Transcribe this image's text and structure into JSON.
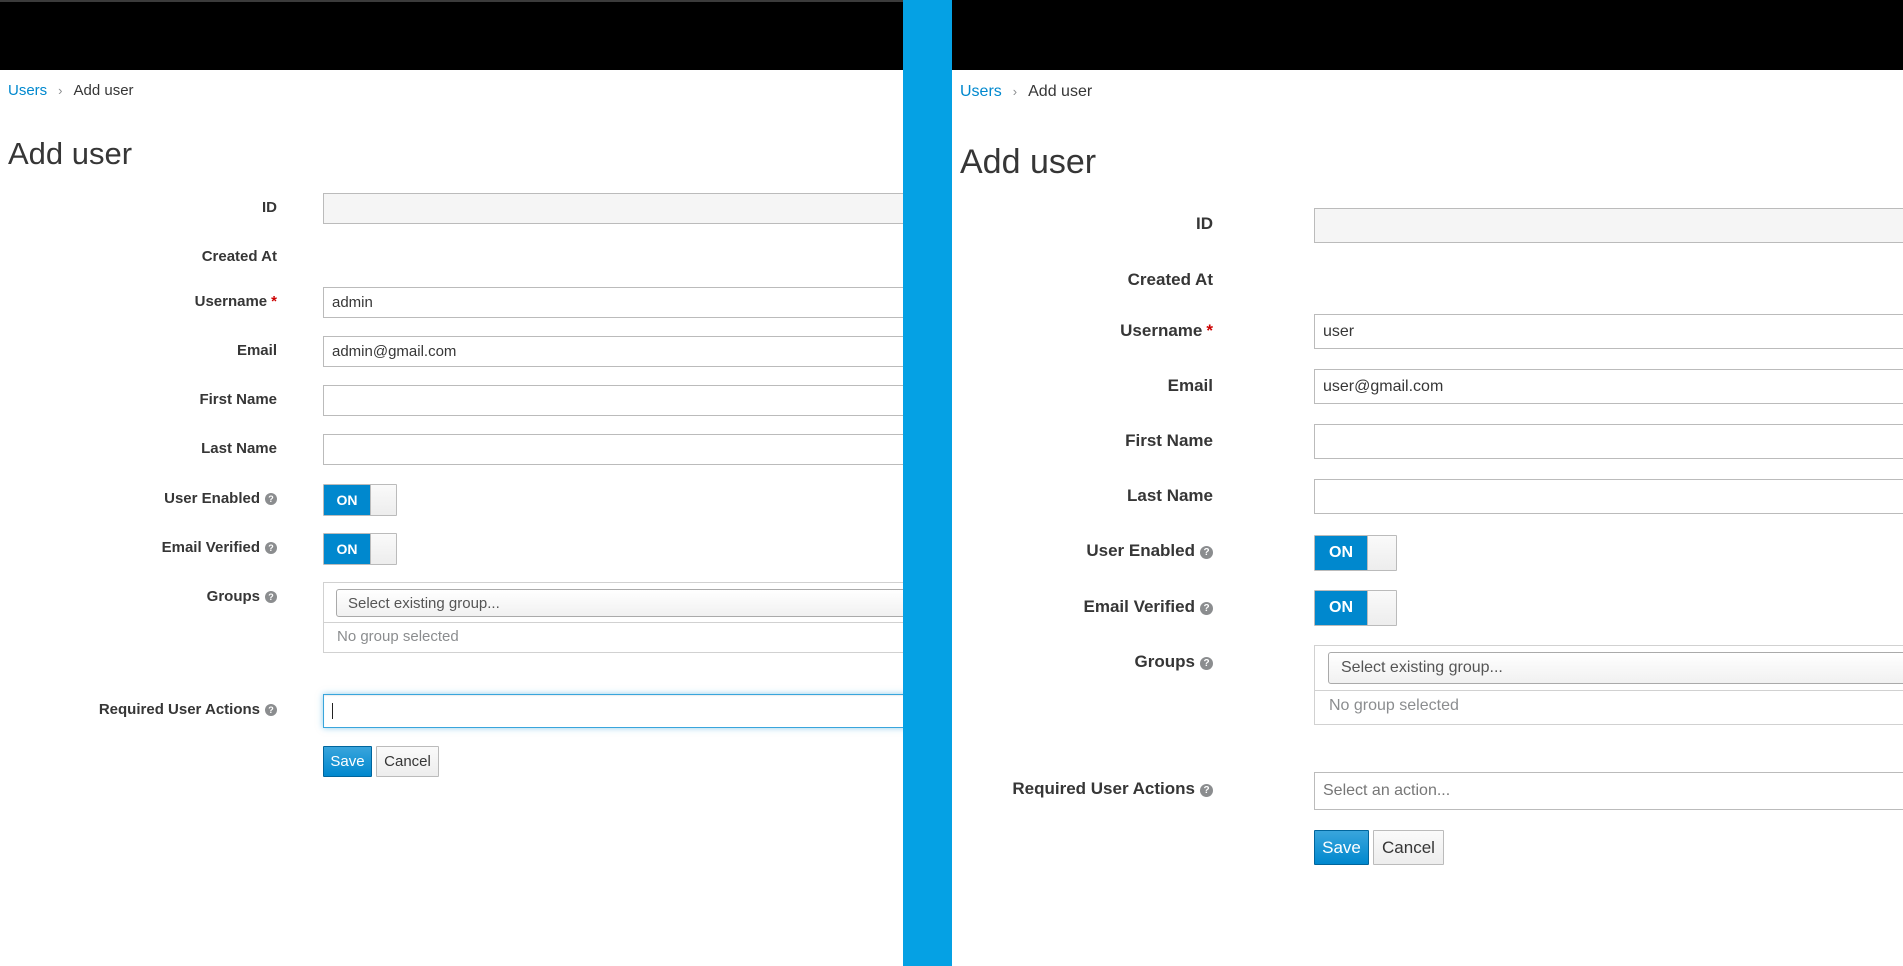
{
  "left": {
    "breadcrumb": {
      "parent": "Users",
      "current": "Add user"
    },
    "title": "Add user",
    "labels": {
      "id": "ID",
      "created_at": "Created At",
      "username": "Username",
      "email": "Email",
      "first_name": "First Name",
      "last_name": "Last Name",
      "user_enabled": "User Enabled",
      "email_verified": "Email Verified",
      "groups": "Groups",
      "required_actions": "Required User Actions"
    },
    "required_marker": "*",
    "help_glyph": "?",
    "values": {
      "id": "",
      "username": "admin",
      "email": "admin@gmail.com",
      "first_name": "",
      "last_name": "",
      "required_actions": ""
    },
    "user_enabled_state": "ON",
    "email_verified_state": "ON",
    "groups_placeholder": "Select existing group...",
    "groups_empty": "No group selected",
    "save_label": "Save",
    "cancel_label": "Cancel"
  },
  "right": {
    "breadcrumb": {
      "parent": "Users",
      "current": "Add user"
    },
    "title": "Add user",
    "labels": {
      "id": "ID",
      "created_at": "Created At",
      "username": "Username",
      "email": "Email",
      "first_name": "First Name",
      "last_name": "Last Name",
      "user_enabled": "User Enabled",
      "email_verified": "Email Verified",
      "groups": "Groups",
      "required_actions": "Required User Actions"
    },
    "required_marker": "*",
    "help_glyph": "?",
    "values": {
      "id": "",
      "username": "user",
      "email": "user@gmail.com",
      "first_name": "",
      "last_name": ""
    },
    "user_enabled_state": "ON",
    "email_verified_state": "ON",
    "groups_placeholder": "Select existing group...",
    "groups_empty": "No group selected",
    "required_actions_placeholder": "Select an action...",
    "save_label": "Save",
    "cancel_label": "Cancel"
  },
  "colors": {
    "divider": "#05a1e4",
    "topbar": "#000000",
    "link": "#0088ce",
    "primary_button": "#0088ce",
    "switch_on": "#0088ce",
    "required_marker": "#cc0000"
  },
  "icons": {
    "help": "question-circle-icon",
    "breadcrumb_separator": "chevron-right-icon"
  }
}
